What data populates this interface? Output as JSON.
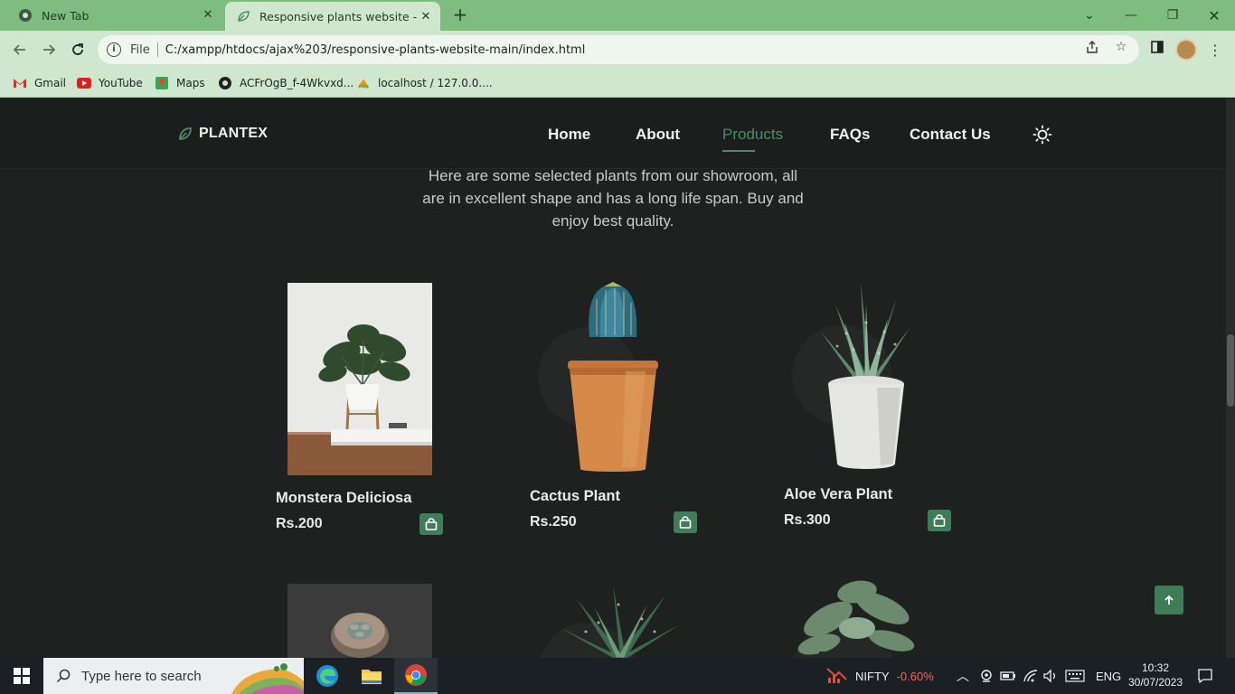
{
  "browser": {
    "tabs": [
      {
        "title": "New Tab",
        "icon": "chrome-icon"
      },
      {
        "title": "Responsive plants website - Bedi",
        "icon": "leaf-icon"
      }
    ],
    "address": {
      "scheme": "File",
      "url": "C:/xampp/htdocs/ajax%203/responsive-plants-website-main/index.html"
    },
    "bookmarks": [
      {
        "label": "Gmail",
        "icon": "gmail-icon"
      },
      {
        "label": "YouTube",
        "icon": "youtube-icon"
      },
      {
        "label": "Maps",
        "icon": "maps-icon"
      },
      {
        "label": "ACFrOgB_f-4Wkvxd...",
        "icon": "globe-icon"
      },
      {
        "label": "localhost / 127.0.0....",
        "icon": "phpmyadmin-icon"
      }
    ]
  },
  "site": {
    "logo": "PLANTEX",
    "nav": [
      "Home",
      "About",
      "Products",
      "FAQs",
      "Contact Us"
    ],
    "active_nav": "Products",
    "accent": "#4b8d66",
    "intro_lines": [
      "Here are some selected plants from our showroom, all",
      "are in excellent shape and has a long life span. Buy and",
      "enjoy best quality."
    ],
    "products": [
      {
        "name": "Monstera Deliciosa",
        "price": "Rs.200"
      },
      {
        "name": "Cactus Plant",
        "price": "Rs.250"
      },
      {
        "name": "Aloe Vera Plant",
        "price": "Rs.300"
      }
    ]
  },
  "taskbar": {
    "search_placeholder": "Type here to search",
    "stock": {
      "name": "NIFTY",
      "change": "-0.60%"
    },
    "language": "ENG",
    "time": "10:32",
    "date": "30/07/2023"
  }
}
